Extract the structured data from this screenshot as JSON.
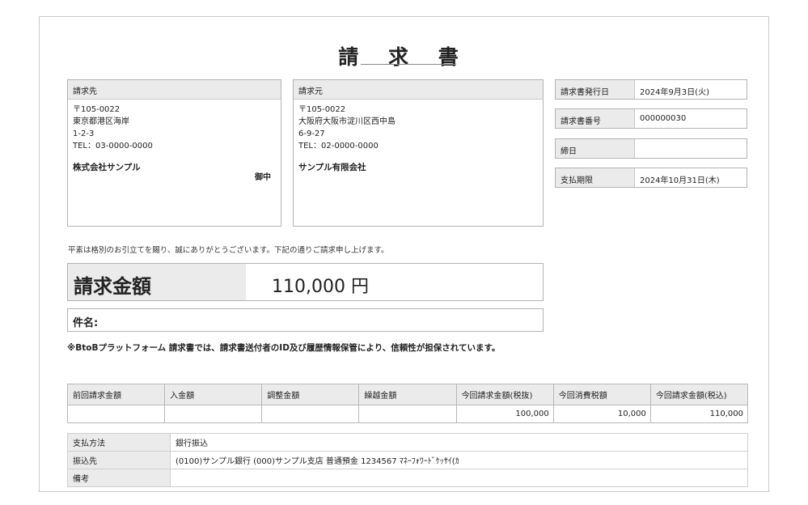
{
  "title": "請 求 書",
  "billing_to": {
    "header": "請求先",
    "postal": "〒105-0022",
    "address1": "東京都港区海岸",
    "address2": "1-2-3",
    "tel": "TEL：03-0000-0000",
    "company": "株式会社サンプル",
    "honorific": "御中"
  },
  "billing_from": {
    "header": "請求元",
    "postal": "〒105-0022",
    "address1": "大阪府大阪市淀川区西中島",
    "address2": "6-9-27",
    "tel": "TEL：02-0000-0000",
    "company": "サンプル有限会社"
  },
  "info": {
    "issue_date_label": "請求書発行日",
    "issue_date": "2024年9月3日(火)",
    "number_label": "請求書番号",
    "number": "000000030",
    "closing_label": "締日",
    "closing": "",
    "due_label": "支払期限",
    "due": "2024年10月31日(木)"
  },
  "greeting": "平素は格別のお引立てを賜り、誠にありがとうございます。下記の通りご請求申し上げます。",
  "amount": {
    "label": "請求金額",
    "value": "110,000 円"
  },
  "subject": {
    "label": "件名:"
  },
  "note": "※BtoBプラットフォーム 請求書では、請求書送付者のID及び履歴情報保管により、信頼性が担保されています。",
  "summary": {
    "headers": [
      "前回請求金額",
      "入金額",
      "調整金額",
      "繰越金額",
      "今回請求金額(税抜)",
      "今回消費税額",
      "今回請求金額(税込)"
    ],
    "values": [
      "",
      "",
      "",
      "",
      "100,000",
      "10,000",
      "110,000"
    ]
  },
  "payment": {
    "method_label": "支払方法",
    "method": "銀行振込",
    "account_label": "振込先",
    "account": "(0100)サンプル銀行 (000)サンプル支店 普通預金 1234567 ﾏﾈｰﾌｫﾜｰﾄﾞｹｯｻｲ(ｶ",
    "remarks_label": "備考",
    "remarks": ""
  }
}
